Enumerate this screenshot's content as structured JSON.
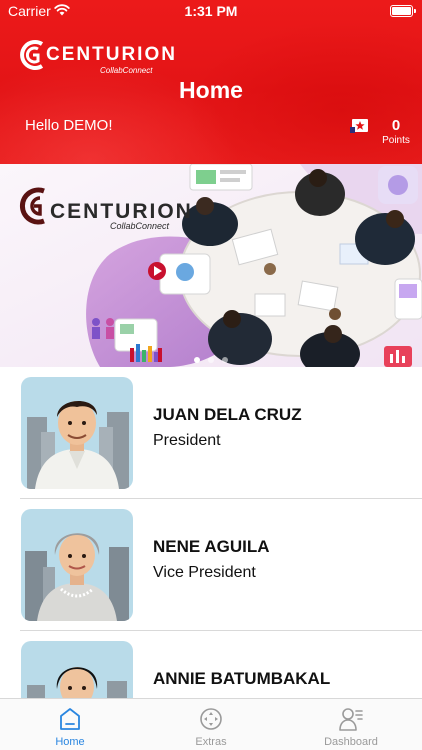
{
  "status_bar": {
    "carrier": "Carrier",
    "time": "1:31 PM"
  },
  "header": {
    "logo_text": "CENTURION",
    "logo_subtext": "CollabConnect",
    "title": "Home",
    "greeting": "Hello DEMO!",
    "points_value": "0",
    "points_label": "Points",
    "points_icon": "star-badge-icon"
  },
  "banner": {
    "logo_text": "CENTURION",
    "logo_subtext": "CollabConnect",
    "pages": 3,
    "active_page": 0
  },
  "officers": [
    {
      "name": "JUAN DELA CRUZ",
      "title": "President",
      "avatar": "man-barong-avatar"
    },
    {
      "name": "NENE AGUILA",
      "title": "Vice President",
      "avatar": "elderly-woman-avatar"
    },
    {
      "name": "ANNIE BATUMBAKAL",
      "title": "",
      "avatar": "woman-avatar"
    }
  ],
  "tabbar": {
    "tabs": [
      {
        "label": "Home",
        "icon": "home-icon",
        "active": true
      },
      {
        "label": "Extras",
        "icon": "extras-icon",
        "active": false
      },
      {
        "label": "Dashboard",
        "icon": "dashboard-icon",
        "active": false
      }
    ]
  },
  "colors": {
    "brand_red": "#e31416",
    "tab_active": "#2a86e0",
    "tab_inactive": "#9a9a9a"
  }
}
